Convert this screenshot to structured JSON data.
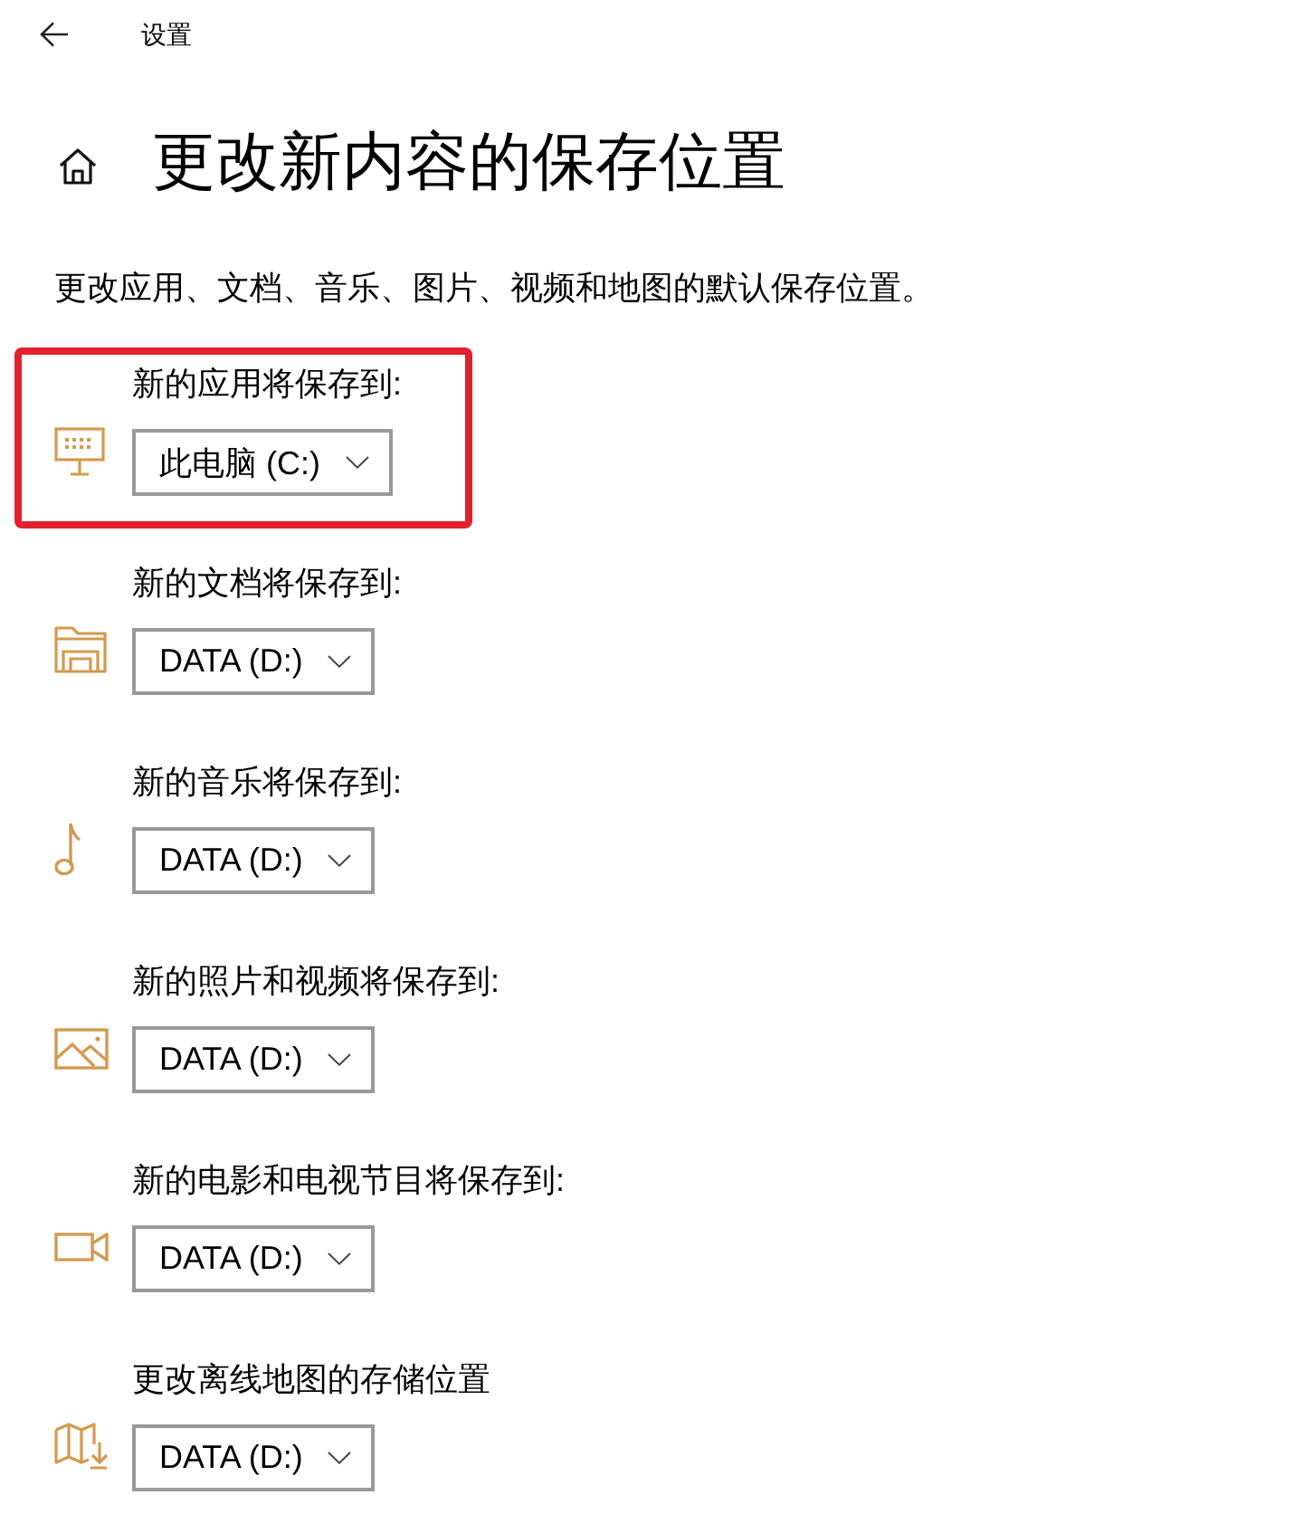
{
  "header": {
    "title": "设置"
  },
  "page": {
    "title": "更改新内容的保存位置",
    "description": "更改应用、文档、音乐、图片、视频和地图的默认保存位置。"
  },
  "locations": [
    {
      "kind": "apps",
      "label": "新的应用将保存到:",
      "value": "此电脑 (C:)",
      "highlighted": true
    },
    {
      "kind": "documents",
      "label": "新的文档将保存到:",
      "value": "DATA (D:)",
      "highlighted": false
    },
    {
      "kind": "music",
      "label": "新的音乐将保存到:",
      "value": "DATA (D:)",
      "highlighted": false
    },
    {
      "kind": "photos",
      "label": "新的照片和视频将保存到:",
      "value": "DATA (D:)",
      "highlighted": false
    },
    {
      "kind": "movies",
      "label": "新的电影和电视节目将保存到:",
      "value": "DATA (D:)",
      "highlighted": false
    },
    {
      "kind": "maps",
      "label": "更改离线地图的存储位置",
      "value": "DATA (D:)",
      "highlighted": false
    }
  ]
}
